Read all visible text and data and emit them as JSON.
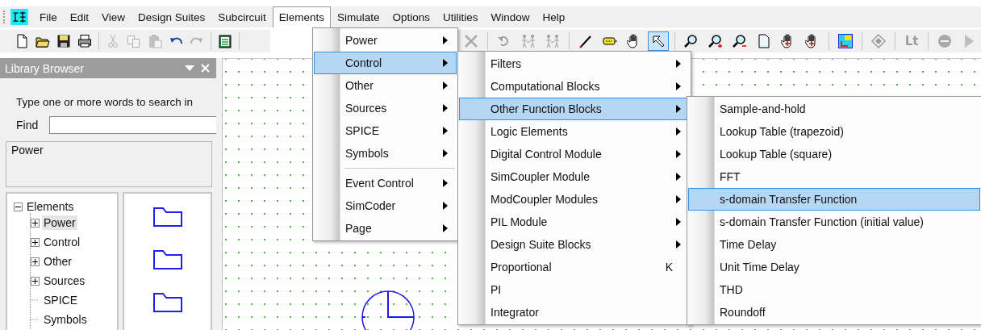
{
  "menubar": [
    {
      "label": "File",
      "selected": false
    },
    {
      "label": "Edit",
      "selected": false
    },
    {
      "label": "View",
      "selected": false
    },
    {
      "label": "Design Suites",
      "selected": false
    },
    {
      "label": "Subcircuit",
      "selected": false
    },
    {
      "label": "Elements",
      "selected": true
    },
    {
      "label": "Simulate",
      "selected": false
    },
    {
      "label": "Options",
      "selected": false
    },
    {
      "label": "Utilities",
      "selected": false
    },
    {
      "label": "Window",
      "selected": false
    },
    {
      "label": "Help",
      "selected": false
    }
  ],
  "toolbar_left": [
    [
      {
        "kind": "new",
        "disabled": false
      },
      {
        "kind": "open",
        "disabled": false
      },
      {
        "kind": "save",
        "disabled": false
      },
      {
        "kind": "print",
        "disabled": false
      }
    ],
    [
      {
        "kind": "cut",
        "disabled": true
      },
      {
        "kind": "copy",
        "disabled": true
      },
      {
        "kind": "paste",
        "disabled": true
      },
      {
        "kind": "undo",
        "disabled": false
      },
      {
        "kind": "redo",
        "disabled": true
      }
    ],
    [
      {
        "kind": "clipboard",
        "disabled": false
      }
    ]
  ],
  "toolbar_right": [
    [
      {
        "kind": "delete",
        "disabled": true,
        "selected": false
      }
    ],
    [
      {
        "kind": "rotate",
        "disabled": true,
        "selected": false
      },
      {
        "kind": "flip",
        "disabled": true,
        "selected": false
      },
      {
        "kind": "flip",
        "disabled": true,
        "selected": false
      }
    ],
    [
      {
        "kind": "wire",
        "disabled": false,
        "selected": false
      },
      {
        "kind": "label",
        "disabled": false,
        "selected": false
      },
      {
        "kind": "hand",
        "disabled": false,
        "selected": false
      },
      {
        "kind": "pointer",
        "disabled": false,
        "selected": true
      }
    ],
    [
      {
        "kind": "zoom",
        "disabled": false,
        "selected": false
      },
      {
        "kind": "zoom-in",
        "disabled": false,
        "selected": false
      },
      {
        "kind": "zoom-out",
        "disabled": false,
        "selected": false
      },
      {
        "kind": "page",
        "disabled": false,
        "selected": false
      },
      {
        "kind": "pan",
        "disabled": false,
        "selected": false
      },
      {
        "kind": "pan",
        "disabled": false,
        "selected": false
      }
    ],
    [
      {
        "kind": "run-tool",
        "disabled": false,
        "selected": false
      }
    ],
    [
      {
        "kind": "diamond",
        "disabled": true,
        "selected": false
      }
    ],
    [
      {
        "kind": "text",
        "label": "Lt",
        "disabled": true,
        "selected": false
      }
    ],
    [
      {
        "kind": "stop",
        "disabled": true,
        "selected": false
      },
      {
        "kind": "play",
        "disabled": true,
        "selected": false
      }
    ]
  ],
  "library_browser": {
    "title": "Library Browser",
    "search_hint": "Type one or more words to search in",
    "find_label": "Find",
    "description": "Power",
    "tree": [
      {
        "label": "Elements",
        "kind": "branch",
        "expanded": true,
        "selected": false,
        "children": [
          {
            "label": "Power",
            "kind": "branch",
            "expanded": false,
            "selected": true
          },
          {
            "label": "Control",
            "kind": "branch",
            "expanded": false,
            "selected": false
          },
          {
            "label": "Other",
            "kind": "branch",
            "expanded": false,
            "selected": false
          },
          {
            "label": "Sources",
            "kind": "branch",
            "expanded": false,
            "selected": false
          },
          {
            "label": "SPICE",
            "kind": "leaf",
            "selected": false
          },
          {
            "label": "Symbols",
            "kind": "leaf",
            "selected": false
          }
        ]
      }
    ],
    "icons": [
      {
        "kind": "folder"
      },
      {
        "kind": "folder"
      },
      {
        "kind": "folder"
      }
    ]
  },
  "menus": [
    {
      "items": [
        {
          "label": "Power",
          "selected": false,
          "submenu": true,
          "separator_before": false
        },
        {
          "label": "Control",
          "selected": true,
          "submenu": true,
          "separator_before": false
        },
        {
          "label": "Other",
          "selected": false,
          "submenu": true,
          "separator_before": false
        },
        {
          "label": "Sources",
          "selected": false,
          "submenu": true,
          "separator_before": false
        },
        {
          "label": "SPICE",
          "selected": false,
          "submenu": true,
          "separator_before": false
        },
        {
          "label": "Symbols",
          "selected": false,
          "submenu": true,
          "separator_before": false
        },
        {
          "label": "Event Control",
          "selected": false,
          "submenu": true,
          "separator_before": true
        },
        {
          "label": "SimCoder",
          "selected": false,
          "submenu": true,
          "separator_before": false
        },
        {
          "label": "Page",
          "selected": false,
          "submenu": true,
          "separator_before": false
        }
      ]
    },
    {
      "items": [
        {
          "label": "Filters",
          "selected": false,
          "submenu": true
        },
        {
          "label": "Computational Blocks",
          "selected": false,
          "submenu": true
        },
        {
          "label": "Other Function Blocks",
          "selected": true,
          "submenu": true
        },
        {
          "label": "Logic Elements",
          "selected": false,
          "submenu": true
        },
        {
          "label": "Digital Control Module",
          "selected": false,
          "submenu": true
        },
        {
          "label": "SimCoupler Module",
          "selected": false,
          "submenu": true
        },
        {
          "label": "ModCoupler Modules",
          "selected": false,
          "submenu": true
        },
        {
          "label": "PIL Module",
          "selected": false,
          "submenu": true
        },
        {
          "label": "Design Suite Blocks",
          "selected": false,
          "submenu": true
        },
        {
          "label": "Proportional",
          "selected": false,
          "submenu": false,
          "shortcut": "K"
        },
        {
          "label": "PI",
          "selected": false,
          "submenu": false
        },
        {
          "label": "Integrator",
          "selected": false,
          "submenu": false
        }
      ]
    },
    {
      "items": [
        {
          "label": "Sample-and-hold",
          "selected": false,
          "submenu": false
        },
        {
          "label": "Lookup Table (trapezoid)",
          "selected": false,
          "submenu": false
        },
        {
          "label": "Lookup Table (square)",
          "selected": false,
          "submenu": false
        },
        {
          "label": "FFT",
          "selected": false,
          "submenu": false
        },
        {
          "label": "s-domain Transfer Function",
          "selected": true,
          "submenu": false
        },
        {
          "label": "s-domain Transfer Function (initial value)",
          "selected": false,
          "submenu": false
        },
        {
          "label": "Time Delay",
          "selected": false,
          "submenu": false
        },
        {
          "label": "Unit Time Delay",
          "selected": false,
          "submenu": false
        },
        {
          "label": "THD",
          "selected": false,
          "submenu": false
        },
        {
          "label": "Roundoff",
          "selected": false,
          "submenu": false
        }
      ]
    }
  ]
}
